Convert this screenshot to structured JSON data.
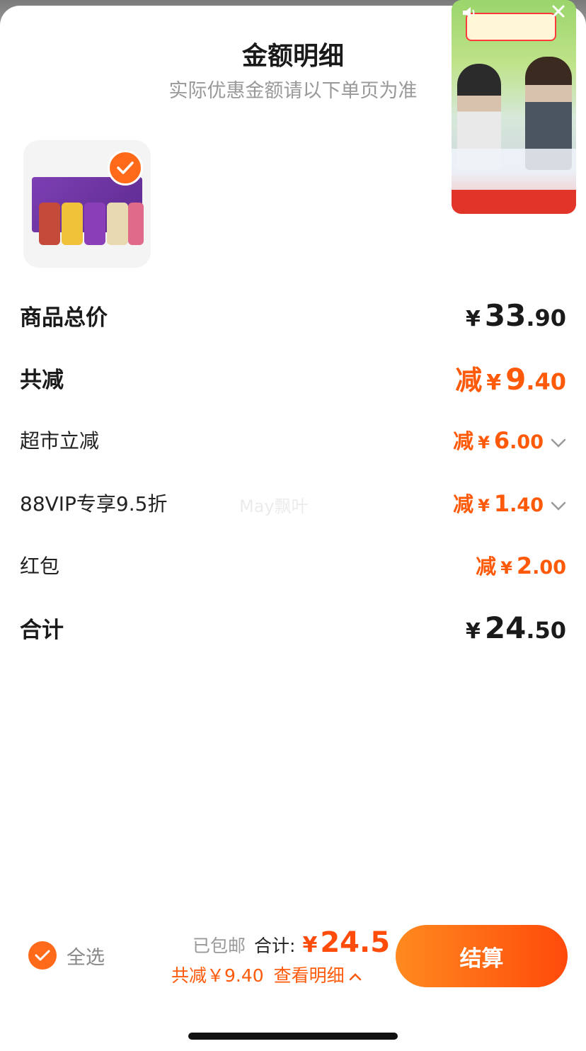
{
  "header": {
    "title": "金额明细",
    "subtitle": "实际优惠金额请以下单页为准"
  },
  "colors": {
    "accent": "#ff5a0a",
    "checkout_gradient_start": "#ff8a1f",
    "checkout_gradient_end": "#ff4a0a"
  },
  "rows": {
    "subtotal": {
      "label": "商品总价",
      "yen": "¥",
      "int": "33",
      "dec": ".90"
    },
    "total_discount": {
      "label": "共减",
      "prefix": "减",
      "yen": "¥",
      "int": "9",
      "dec": ".40"
    },
    "supermarket": {
      "label": "超市立减",
      "prefix": "减",
      "yen": "¥",
      "int": "6",
      "dec": ".00"
    },
    "vip": {
      "label": "88VIP专享9.5折",
      "prefix": "减",
      "yen": "¥",
      "int": "1",
      "dec": ".40"
    },
    "red_packet": {
      "label": "红包",
      "prefix": "减",
      "yen": "¥",
      "int": "2",
      "dec": ".00"
    },
    "total": {
      "label": "合计",
      "yen": "¥",
      "int": "24",
      "dec": ".50"
    }
  },
  "watermark": "May飘叶",
  "bottom_bar": {
    "select_all": "全选",
    "shipping": "已包邮",
    "total_label": "合计:",
    "yen": "¥",
    "total_value": "24.5",
    "discount_text": "共减￥9.40",
    "view_details": "查看明细",
    "checkout": "结算"
  },
  "icons": {
    "check": "check-icon",
    "chevron": "chevron-down-icon",
    "chevron_up": "chevron-up-icon",
    "mute": "speaker-icon",
    "close": "close-icon"
  }
}
